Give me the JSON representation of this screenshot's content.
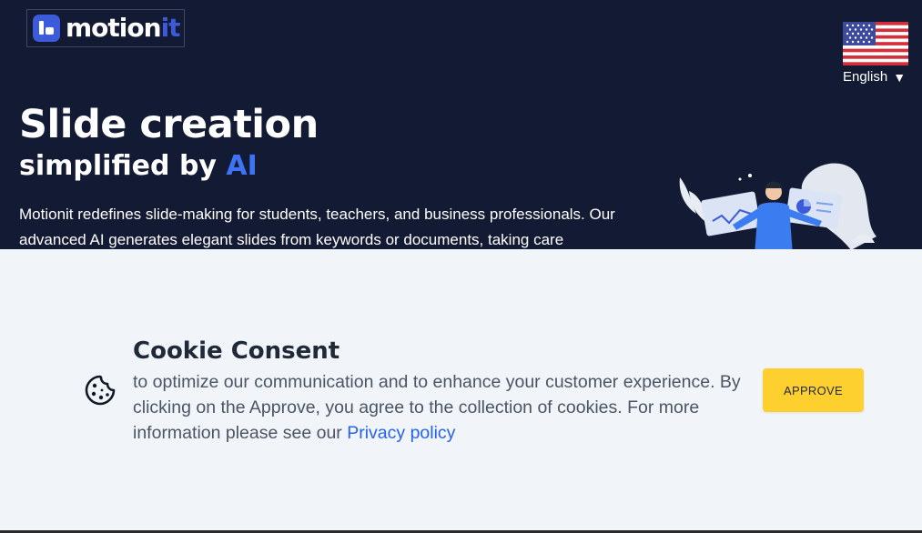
{
  "brand": {
    "logo_text_main": "motion",
    "logo_text_accent": "it",
    "accent_color": "#3b5bdb"
  },
  "language": {
    "label": "English",
    "caret": "▼",
    "flag_icon": "us-flag-icon"
  },
  "hero": {
    "title": "Slide creation",
    "subtitle_prefix": "simplified by ",
    "subtitle_accent": "AI",
    "description": "Motionit redefines slide-making for students, teachers, and business professionals. Our advanced AI generates elegant slides from keywords or documents, taking care",
    "background_color": "#131a33",
    "illustration_icon": "presenter-illustration"
  },
  "cookie": {
    "title": "Cookie Consent",
    "text": "to optimize our communication and to enhance your customer experience. By clicking on the Approve, you agree to the collection of cookies. For more information please see our ",
    "link_label": "Privacy policy",
    "approve_label": "APPROVE",
    "icon": "cookie-icon",
    "button_color": "#fdd02f",
    "background_color": "#f1f4f9"
  }
}
